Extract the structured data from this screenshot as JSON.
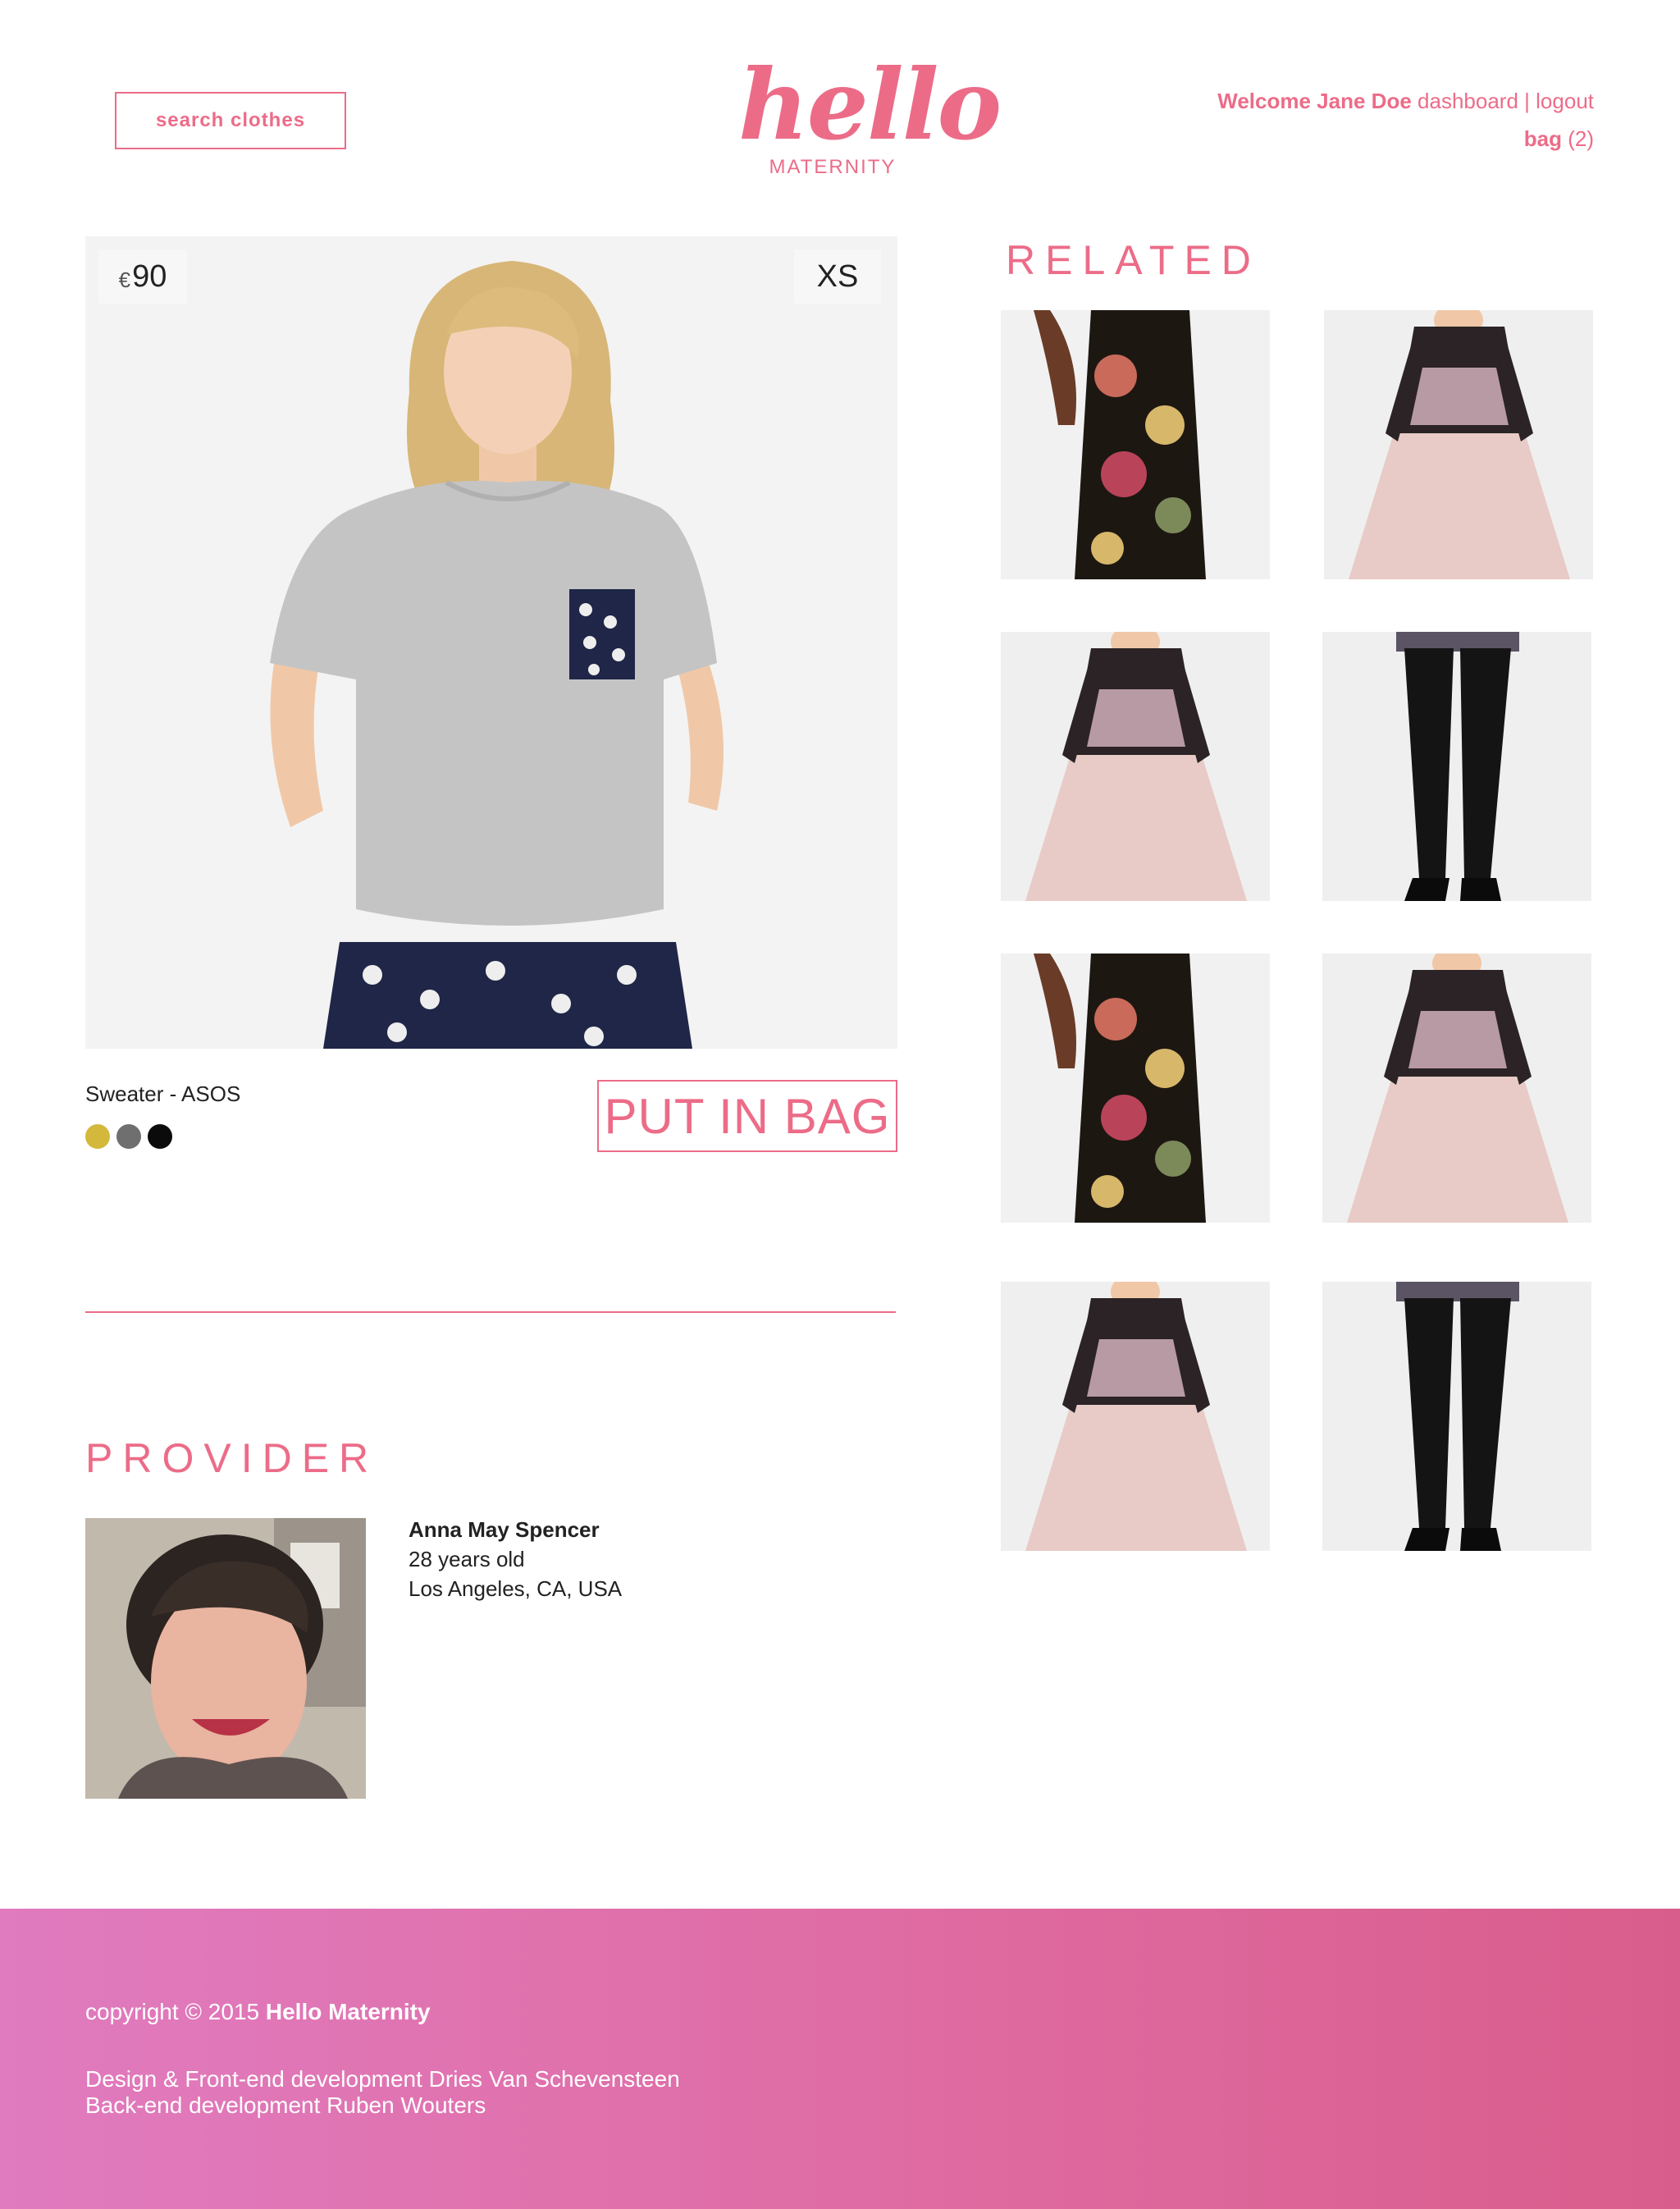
{
  "header": {
    "search_label": "search clothes",
    "logo_word": "hello",
    "logo_sub": "MATERNITY",
    "welcome": "Welcome Jane Doe",
    "dashboard": "dashboard",
    "separator": "|",
    "logout": "logout",
    "bag_label": "bag",
    "bag_count": "(2)"
  },
  "product": {
    "currency": "€",
    "price": "90",
    "size": "XS",
    "name": "Sweater - ASOS",
    "colors": [
      "#d4b83c",
      "#6f6f6f",
      "#0b0b0b"
    ],
    "bag_button": "PUT IN BAG"
  },
  "provider": {
    "title": "PROVIDER",
    "name": "Anna May Spencer",
    "age": "28 years old",
    "location": "Los Angeles, CA, USA"
  },
  "related": {
    "title": "RELATED",
    "items": [
      "floral-blouse",
      "lace-dress",
      "lace-dress",
      "leather-leggings",
      "floral-blouse",
      "lace-dress",
      "lace-dress",
      "leather-leggings"
    ]
  },
  "footer": {
    "copyright_prefix": "copyright © 2015",
    "brand": "Hello Maternity",
    "credit1": "Design & Front-end development Dries Van Schevensteen",
    "credit2": "Back-end development Ruben Wouters"
  },
  "colors": {
    "accent": "#ec6c88",
    "footer": "#df6ba2"
  }
}
